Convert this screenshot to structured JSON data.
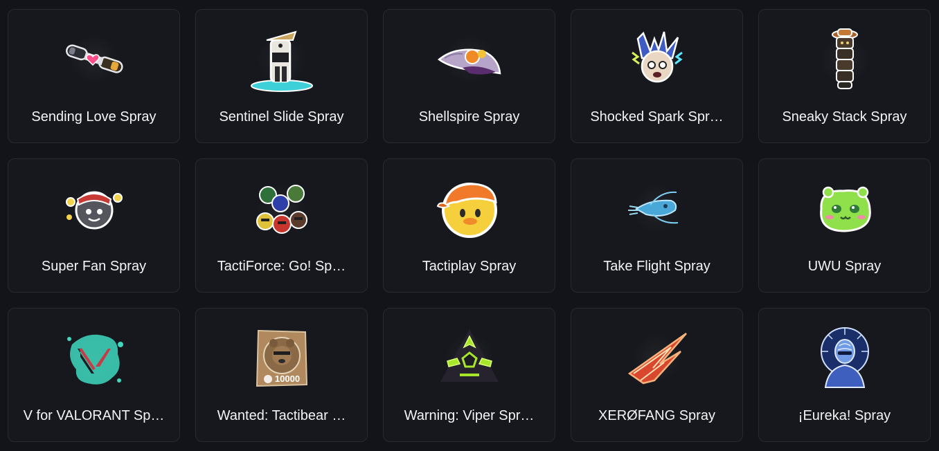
{
  "sprays": [
    {
      "name": "Sending Love Spray",
      "icon": "sending-love-spray-icon"
    },
    {
      "name": "Sentinel Slide Spray",
      "icon": "sentinel-slide-spray-icon"
    },
    {
      "name": "Shellspire Spray",
      "icon": "shellspire-spray-icon"
    },
    {
      "name": "Shocked Spark Spr…",
      "icon": "shocked-spark-spray-icon"
    },
    {
      "name": "Sneaky Stack Spray",
      "icon": "sneaky-stack-spray-icon"
    },
    {
      "name": "Super Fan Spray",
      "icon": "super-fan-spray-icon"
    },
    {
      "name": "TactiForce: Go! Sp…",
      "icon": "tactiforce-go-spray-icon"
    },
    {
      "name": "Tactiplay Spray",
      "icon": "tactiplay-spray-icon"
    },
    {
      "name": "Take Flight Spray",
      "icon": "take-flight-spray-icon"
    },
    {
      "name": "UWU Spray",
      "icon": "uwu-spray-icon"
    },
    {
      "name": "V for VALORANT Sp…",
      "icon": "v-for-valorant-spray-icon"
    },
    {
      "name": "Wanted: Tactibear …",
      "icon": "wanted-tactibear-spray-icon"
    },
    {
      "name": "Warning: Viper Spr…",
      "icon": "warning-viper-spray-icon"
    },
    {
      "name": "XERØFANG Spray",
      "icon": "xerofang-spray-icon"
    },
    {
      "name": "¡Eureka! Spray",
      "icon": "eureka-spray-icon"
    }
  ],
  "wanted_bounty": "10000",
  "colors": {
    "background": "#121419",
    "card": "#16181d",
    "card_border": "#272a31",
    "text": "#f4f4f6"
  }
}
